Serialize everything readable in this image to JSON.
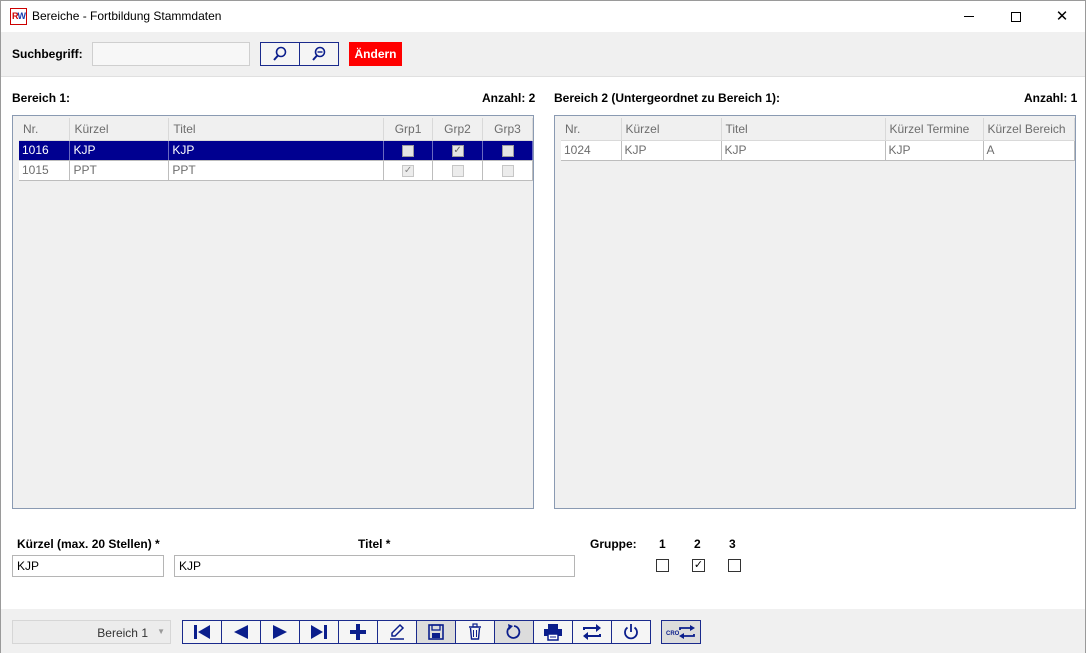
{
  "window": {
    "title": "Bereiche - Fortbildung Stammdaten",
    "icon_text_a": "R",
    "icon_text_b": "W"
  },
  "search": {
    "label": "Suchbegriff:",
    "value": "",
    "aendern_label": "Ändern"
  },
  "left": {
    "title": "Bereich 1:",
    "count": "Anzahl: 2",
    "columns": [
      "Nr.",
      "Kürzel",
      "Titel",
      "Grp1",
      "Grp2",
      "Grp3"
    ],
    "rows": [
      {
        "nr": "1016",
        "kuerzel": "KJP",
        "titel": "KJP",
        "grp1": false,
        "grp2": true,
        "grp3": false
      },
      {
        "nr": "1015",
        "kuerzel": "PPT",
        "titel": "PPT",
        "grp1": true,
        "grp2": false,
        "grp3": false
      }
    ]
  },
  "right": {
    "title": "Bereich 2 (Untergeordnet zu Bereich 1):",
    "count": "Anzahl: 1",
    "columns": [
      "Nr.",
      "Kürzel",
      "Titel",
      "Kürzel Termine",
      "Kürzel Bereich"
    ],
    "rows": [
      {
        "nr": "1024",
        "kuerzel": "KJP",
        "titel": "KJP",
        "kuerzel_termine": "KJP",
        "kuerzel_bereich": "A"
      }
    ]
  },
  "form": {
    "kuerzel_label": "Kürzel (max. 20 Stellen) *",
    "kuerzel_value": "KJP",
    "titel_label": "Titel *",
    "titel_value": "KJP",
    "gruppe_label": "Gruppe:",
    "groups": [
      {
        "label": "1",
        "checked": false
      },
      {
        "label": "2",
        "checked": true
      },
      {
        "label": "3",
        "checked": false
      }
    ]
  },
  "bottom": {
    "combo_value": "Bereich 1",
    "cro_label": "CRO"
  },
  "colors": {
    "accent": "#000090",
    "nav_icon": "#0b1e8c",
    "danger": "#ff0000"
  },
  "icons": [
    "search-icon",
    "zoom-out-icon",
    "first-record-icon",
    "prev-record-icon",
    "next-record-icon",
    "last-record-icon",
    "add-icon",
    "edit-icon",
    "save-icon",
    "delete-icon",
    "refresh-icon",
    "print-icon",
    "transfer-icon",
    "power-icon",
    "cro-transfer-icon"
  ]
}
